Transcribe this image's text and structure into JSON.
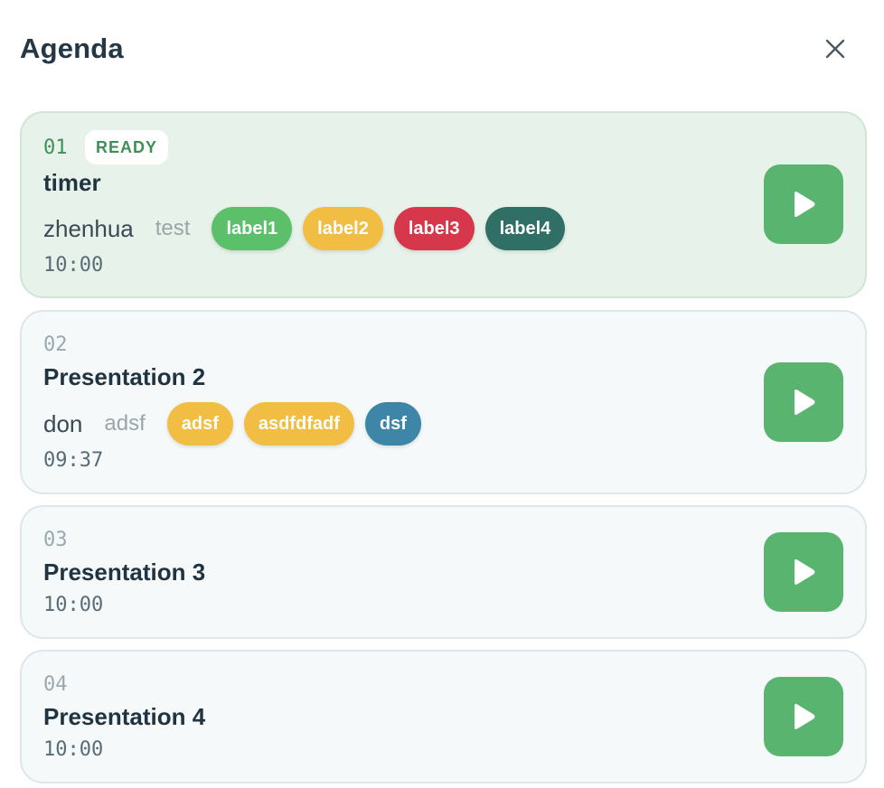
{
  "header": {
    "title": "Agenda",
    "close_icon": "close-icon"
  },
  "colors": {
    "accent": "#58b46e",
    "ready_bg": "#e7f3ea",
    "item_bg": "#f5f9fa"
  },
  "items": [
    {
      "number": "01",
      "status": "READY",
      "name": "timer",
      "presenter": "zhenhua",
      "note": "test",
      "labels": [
        {
          "text": "label1",
          "color": "#5cbf6a"
        },
        {
          "text": "label2",
          "color": "#f1bd43"
        },
        {
          "text": "label3",
          "color": "#d6374a"
        },
        {
          "text": "label4",
          "color": "#2f6f66"
        }
      ],
      "time": "10:00",
      "action_icon": "play-icon"
    },
    {
      "number": "02",
      "name": "Presentation 2",
      "presenter": "don",
      "note": "adsf",
      "labels": [
        {
          "text": "adsf",
          "color": "#f1bd43"
        },
        {
          "text": "asdfdfadf",
          "color": "#f1bd43"
        },
        {
          "text": "dsf",
          "color": "#3d86a8"
        }
      ],
      "time": "09:37",
      "action_icon": "play-icon"
    },
    {
      "number": "03",
      "name": "Presentation 3",
      "time": "10:00",
      "action_icon": "play-icon"
    },
    {
      "number": "04",
      "name": "Presentation 4",
      "time": "10:00",
      "action_icon": "play-icon"
    }
  ]
}
